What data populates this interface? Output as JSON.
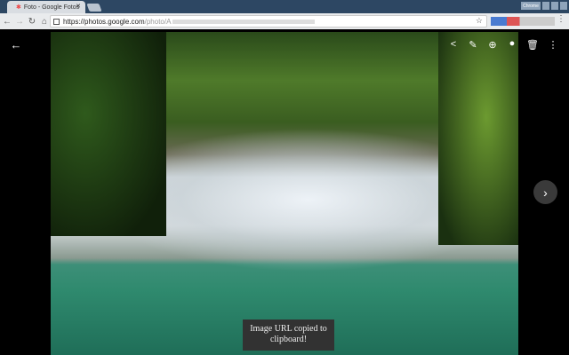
{
  "browser": {
    "tab_title": "Foto - Google Fotos",
    "url_host": "https://photos.google.com",
    "url_path": "/photo/A",
    "win_user": "Chrome"
  },
  "viewer": {
    "back_icon": "arrow-left",
    "actions": [
      "share",
      "edit",
      "zoom",
      "info",
      "delete",
      "more"
    ],
    "next_icon": "chevron-right"
  },
  "toast": {
    "message": "Image URL copied to clipboard!"
  }
}
